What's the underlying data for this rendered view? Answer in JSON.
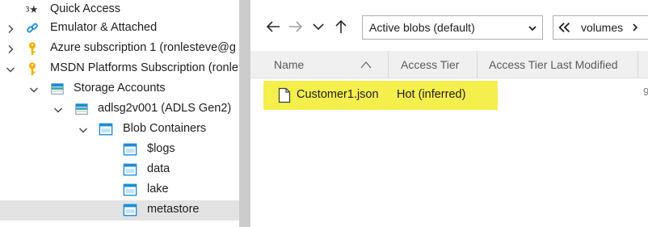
{
  "tree": {
    "items": [
      {
        "label": "Quick Access",
        "icon": "quick-access-icon",
        "chevron": "none"
      },
      {
        "label": "Emulator & Attached",
        "icon": "link-icon",
        "chevron": "right"
      },
      {
        "label": "Azure subscription 1 (ronlesteve@g",
        "icon": "key-icon",
        "chevron": "right"
      },
      {
        "label": "MSDN Platforms Subscription (ronle",
        "icon": "key-icon",
        "chevron": "down"
      },
      {
        "label": "Storage Accounts",
        "icon": "storage-accounts-icon",
        "chevron": "down"
      },
      {
        "label": "adlsg2v001 (ADLS Gen2)",
        "icon": "storage-account-icon",
        "chevron": "down"
      },
      {
        "label": "Blob Containers",
        "icon": "blob-containers-icon",
        "chevron": "down"
      },
      {
        "label": "$logs",
        "icon": "container-icon",
        "chevron": "none"
      },
      {
        "label": "data",
        "icon": "container-icon",
        "chevron": "none"
      },
      {
        "label": "lake",
        "icon": "container-icon",
        "chevron": "none"
      },
      {
        "label": "metastore",
        "icon": "container-icon",
        "chevron": "none",
        "selected": true
      }
    ]
  },
  "toolbar": {
    "back_icon": "back-arrow-icon",
    "forward_icon": "forward-arrow-icon",
    "dropdown_icon": "chevron-down-icon",
    "up_icon": "up-arrow-icon",
    "view_select": "Active blobs (default)",
    "breadcrumb": "volumes"
  },
  "grid": {
    "columns": [
      "Name",
      "Access Tier",
      "Access Tier Last Modified"
    ],
    "rows": [
      {
        "name": "Customer1.json",
        "access_tier": "Hot (inferred)",
        "last_modified": ""
      }
    ],
    "edge_fragment": "9"
  },
  "colors": {
    "highlight": "#f5ef4d",
    "key": "#f2b100",
    "azure_blue": "#1a8cd8",
    "selected_row": "#e3e3e3",
    "splitter": "#cccccc"
  }
}
